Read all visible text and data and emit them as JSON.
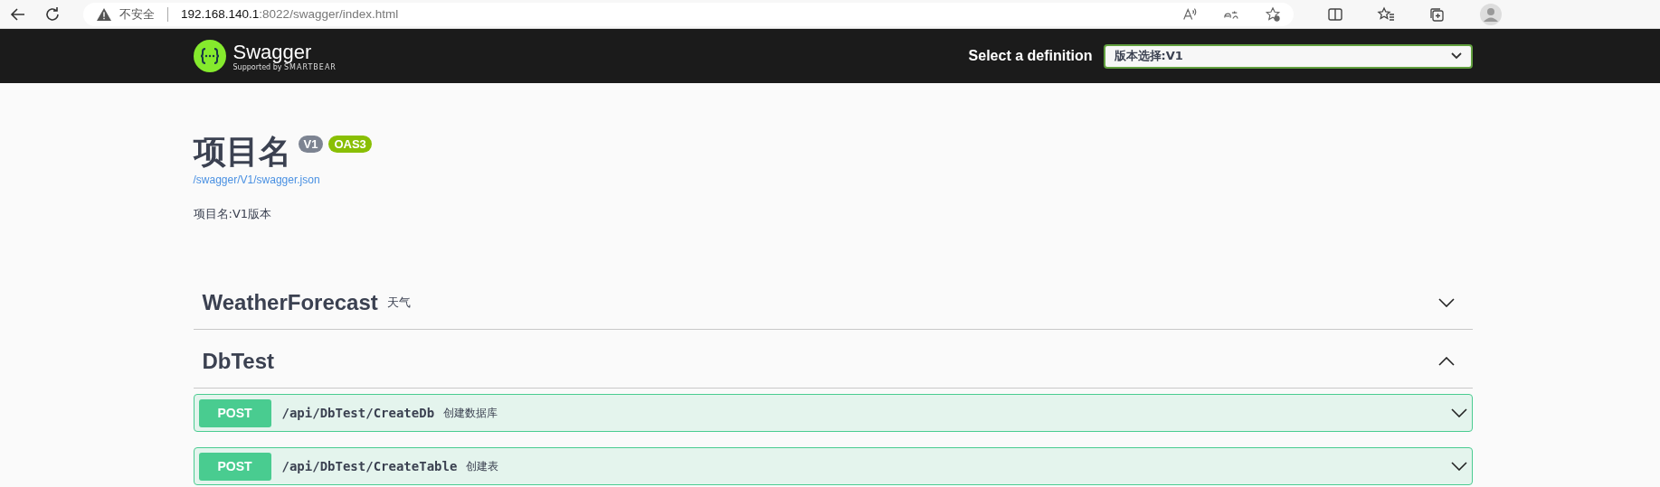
{
  "browser": {
    "security_label": "不安全",
    "url_host": "192.168.140.1",
    "url_rest": ":8022/swagger/index.html"
  },
  "topbar": {
    "logo_text": "Swagger",
    "logo_sub_prefix": "Supported by",
    "logo_sub_brand": "SMARTBEAR",
    "definition_label": "Select a definition",
    "definition_value": "版本选择:V1"
  },
  "info": {
    "title": "项目名",
    "version": "V1",
    "oas": "OAS3",
    "spec_link": "/swagger/V1/swagger.json",
    "description": "项目名:V1版本"
  },
  "tags": [
    {
      "name": "WeatherForecast",
      "description": "天气",
      "expanded": false
    },
    {
      "name": "DbTest",
      "expanded": true,
      "operations": [
        {
          "method": "POST",
          "path": "/api/DbTest/CreateDb",
          "summary": "创建数据库"
        },
        {
          "method": "POST",
          "path": "/api/DbTest/CreateTable",
          "summary": "创建表"
        }
      ]
    }
  ]
}
